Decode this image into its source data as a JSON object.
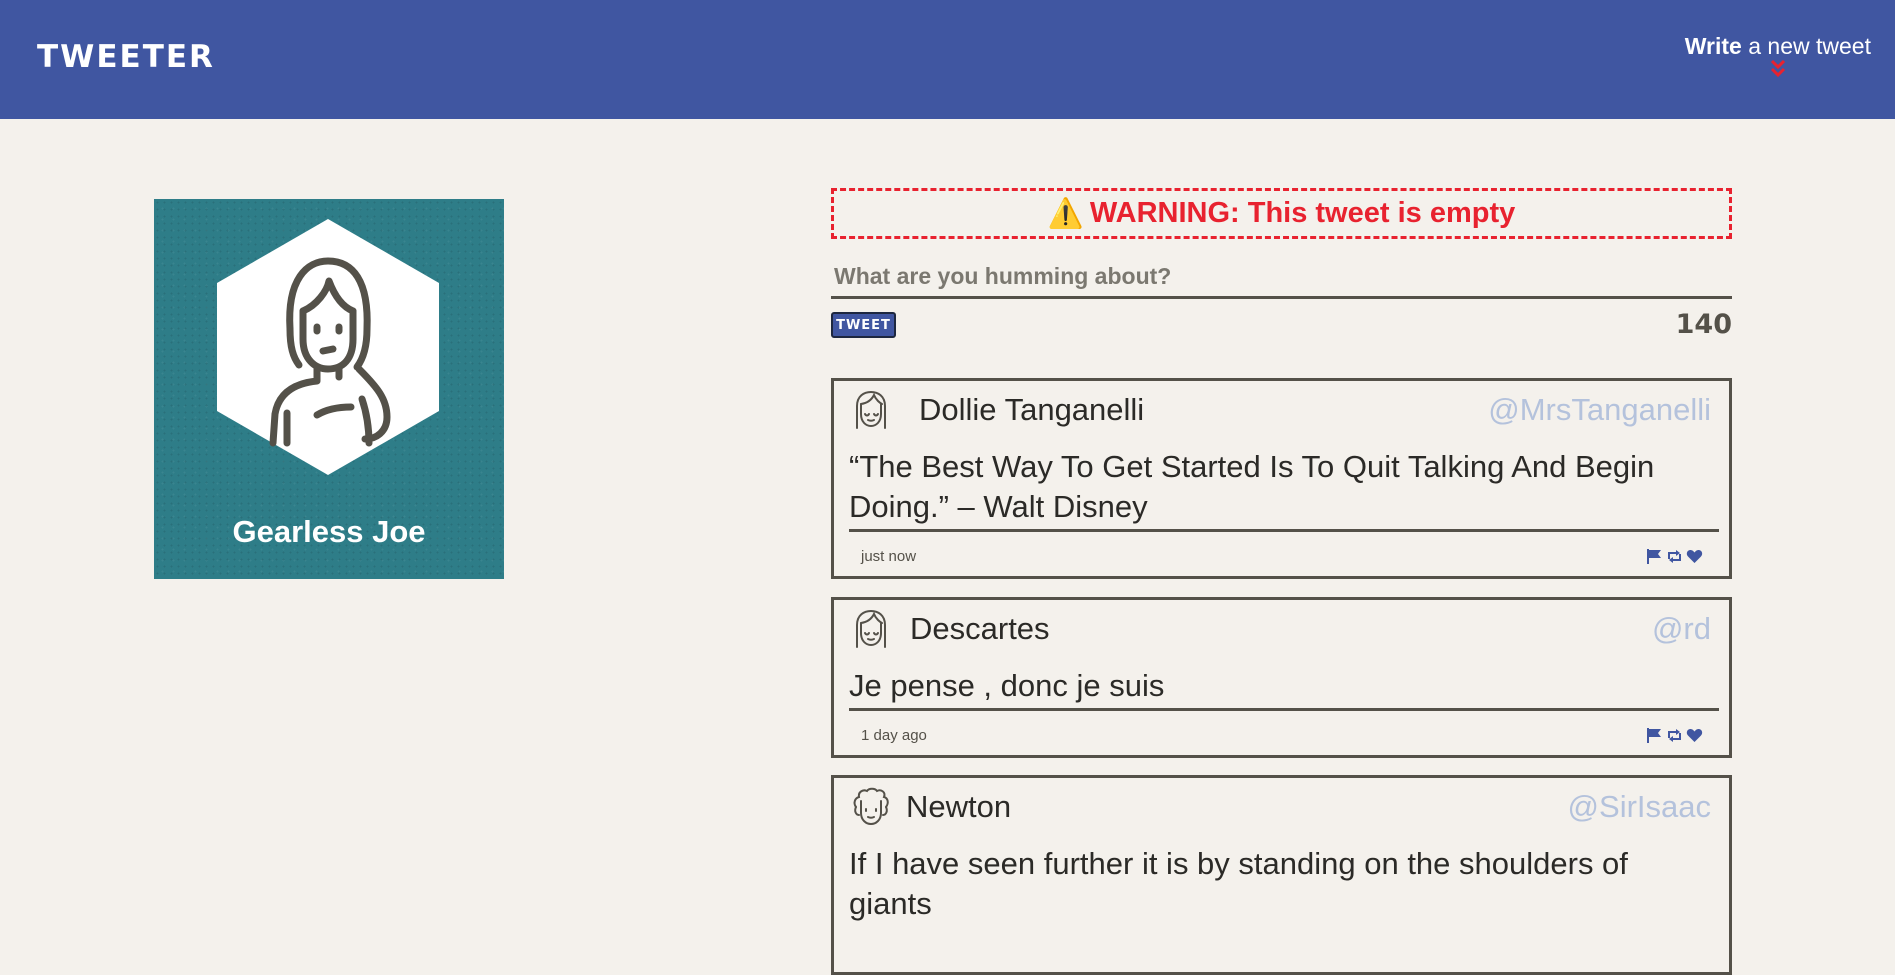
{
  "nav": {
    "brand": "TWEETER",
    "compose_strong": "Write",
    "compose_rest": " a new tweet",
    "compose_icon": "double-chevron-down-icon"
  },
  "profile": {
    "name": "Gearless Joe",
    "avatar_icon": "woman-avatar-icon"
  },
  "composer": {
    "warning_icon": "⚠️",
    "warning_text": "WARNING: This tweet is empty",
    "placeholder": "What are you humming about?",
    "button_label": "TWEET",
    "counter": "140"
  },
  "tweets": [
    {
      "name": "Dollie Tanganelli",
      "handle": "@MrsTanganelli",
      "text": "“The Best Way To Get Started Is To Quit Talking And Begin Doing.” – Walt Disney",
      "time": "just now",
      "avatar_icon": "woman-face-icon"
    },
    {
      "name": "Descartes",
      "handle": "@rd",
      "text": "Je pense , donc je suis",
      "time": "1 day ago",
      "avatar_icon": "woman-face-icon"
    },
    {
      "name": "Newton",
      "handle": "@SirIsaac",
      "text": "If I have seen further it is by standing on the shoulders of giants",
      "time": "",
      "avatar_icon": "curly-hair-face-icon"
    }
  ],
  "action_icons": [
    "flag-icon",
    "retweet-icon",
    "heart-icon"
  ],
  "colors": {
    "nav": "#4056a1",
    "background": "#f4f1ec",
    "profile_card": "#2e7d88",
    "warning": "#e8222f",
    "handle": "#b4c2dc",
    "text": "#545149",
    "accent": "#4056a1"
  }
}
